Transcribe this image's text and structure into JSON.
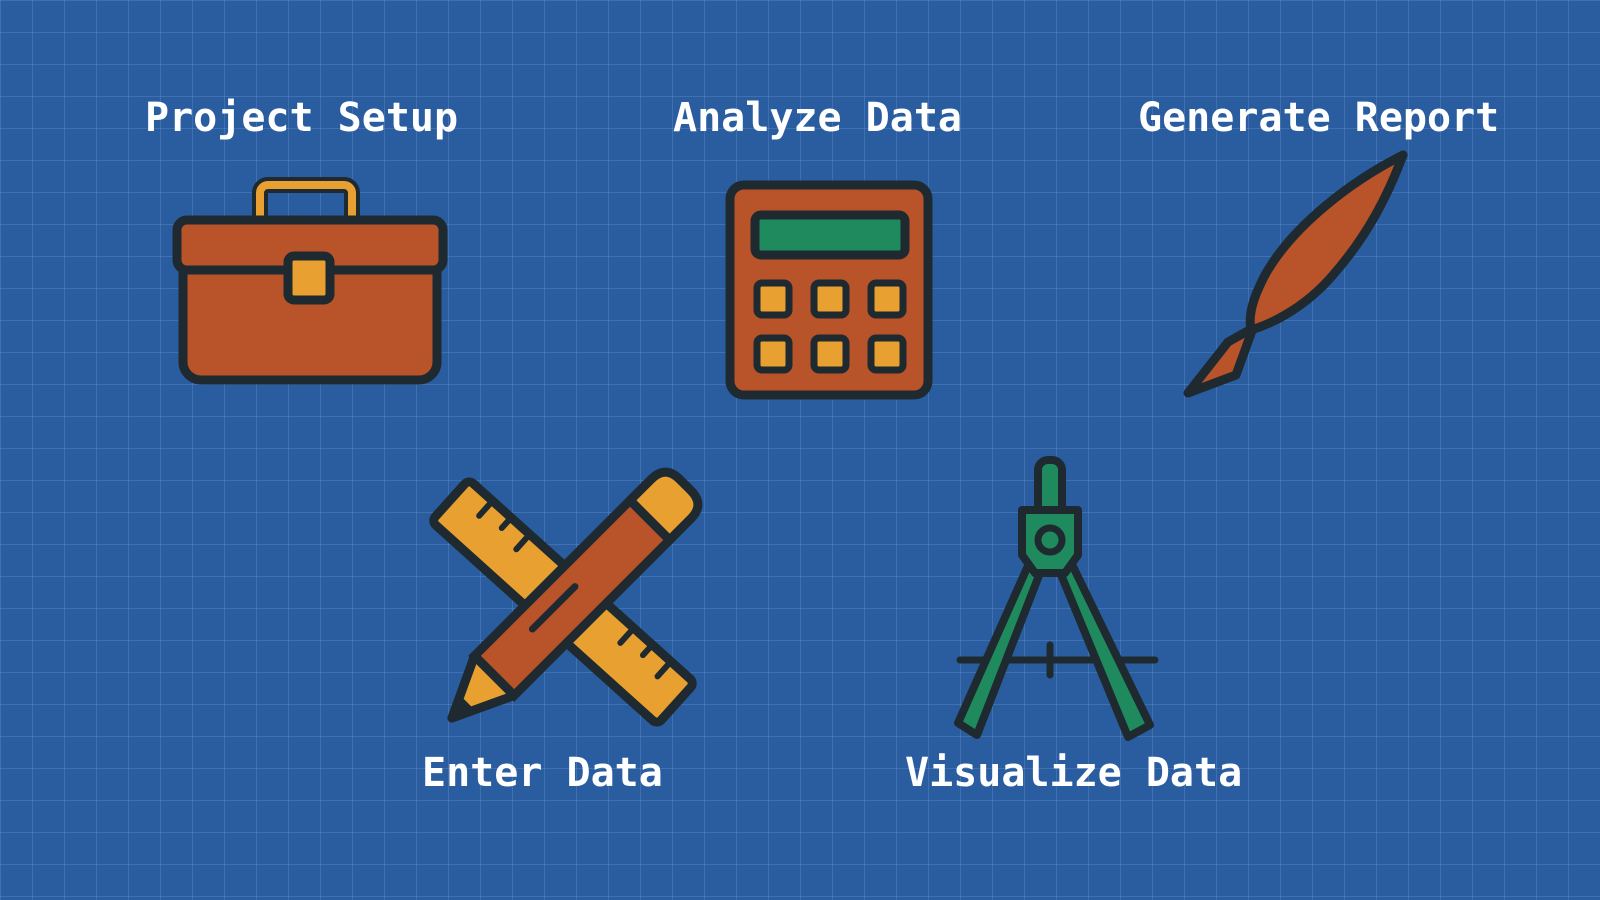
{
  "steps": {
    "project_setup": {
      "label": "Project Setup",
      "icon": "toolbox-icon"
    },
    "analyze_data": {
      "label": "Analyze Data",
      "icon": "calculator-icon"
    },
    "generate_report": {
      "label": "Generate Report",
      "icon": "quill-pen-icon"
    },
    "enter_data": {
      "label": "Enter Data",
      "icon": "ruler-pencil-icon"
    },
    "visualize_data": {
      "label": "Visualize Data",
      "icon": "compass-icon"
    }
  },
  "colors": {
    "background": "#2a5da0",
    "outline": "#1f2a30",
    "rust": "#b8532a",
    "amber": "#e8a030",
    "green": "#1f8a5e",
    "text": "#ffffff"
  }
}
